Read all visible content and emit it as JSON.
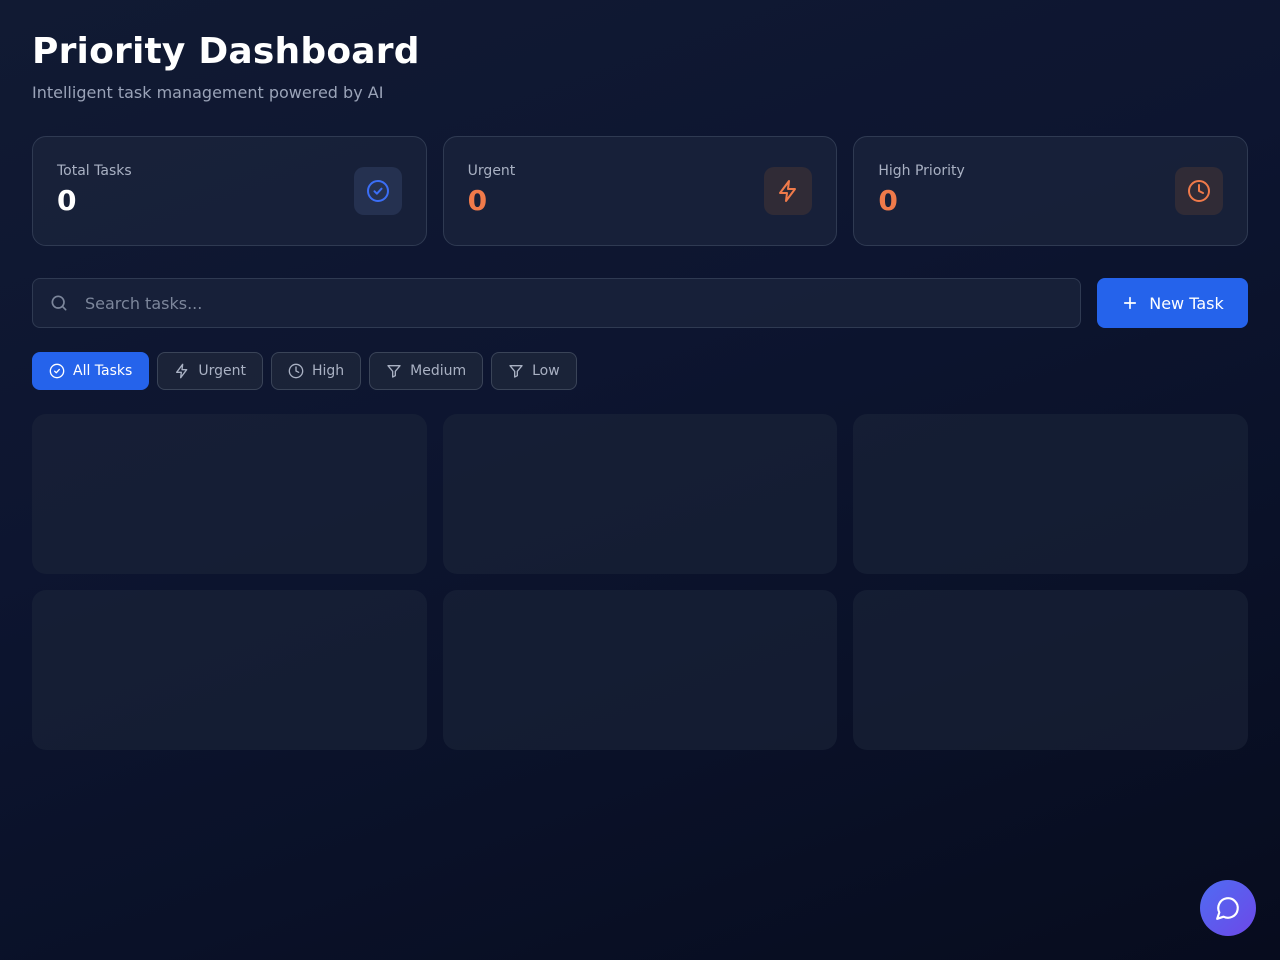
{
  "header": {
    "title": "Priority Dashboard",
    "subtitle": "Intelligent task management powered by AI"
  },
  "stats": [
    {
      "label": "Total Tasks",
      "value": "0",
      "icon": "check-circle-icon",
      "color": "#ffffff",
      "icon_color": "#3b6ef6"
    },
    {
      "label": "Urgent",
      "value": "0",
      "icon": "lightning-icon",
      "color": "#f07a4a",
      "icon_color": "#f07a4a"
    },
    {
      "label": "High Priority",
      "value": "0",
      "icon": "clock-icon",
      "color": "#f07a4a",
      "icon_color": "#f07a4a"
    }
  ],
  "search": {
    "placeholder": "Search tasks..."
  },
  "new_task_label": "New Task",
  "filters": [
    {
      "label": "All Tasks",
      "icon": "check-circle-icon",
      "active": true
    },
    {
      "label": "Urgent",
      "icon": "lightning-icon",
      "active": false
    },
    {
      "label": "High",
      "icon": "clock-icon",
      "active": false
    },
    {
      "label": "Medium",
      "icon": "filter-icon",
      "active": false
    },
    {
      "label": "Low",
      "icon": "filter-icon",
      "active": false
    }
  ],
  "loading_cards": 6,
  "colors": {
    "accent": "#2563eb",
    "warning": "#f07a4a",
    "background": "#0d1530"
  }
}
